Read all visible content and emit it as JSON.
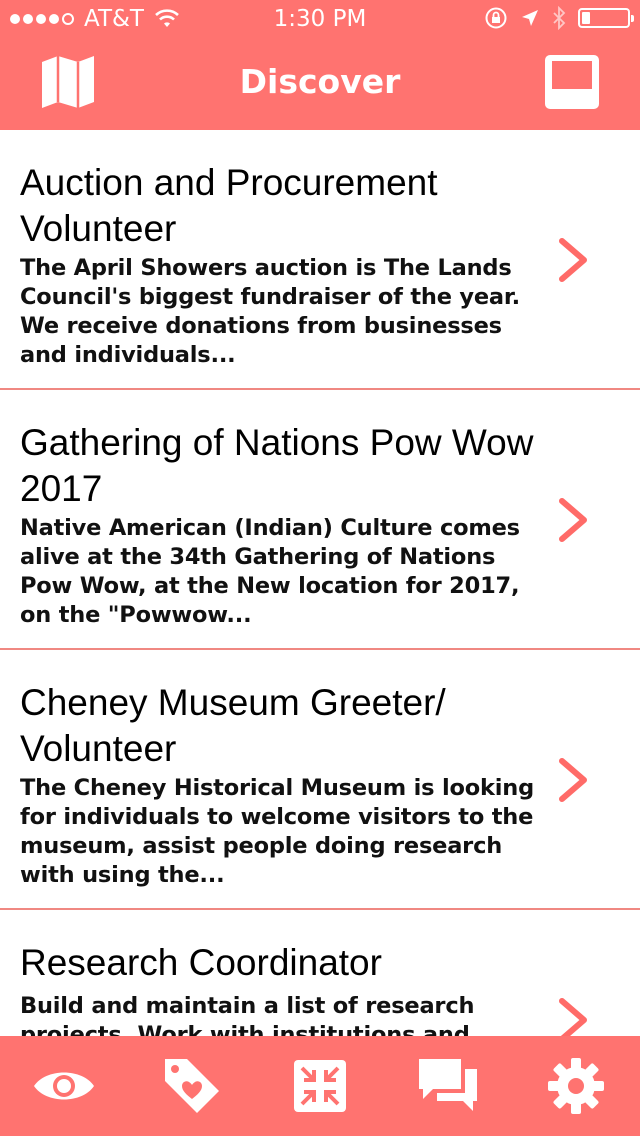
{
  "status_bar": {
    "carrier": "AT&T",
    "time": "1:30 PM",
    "signal_dots_filled": 4,
    "signal_dots_total": 5
  },
  "nav": {
    "title": "Discover",
    "left_icon": "map-icon",
    "right_icon": "inbox-icon"
  },
  "opportunities": [
    {
      "title": "Auction and Procurement Volunteer",
      "description": "The April Showers auction is The Lands Council's biggest fundraiser of the year. We receive donations from businesses and individuals..."
    },
    {
      "title": "Gathering of Nations Pow Wow 2017",
      "description": "Native American (Indian) Culture comes alive at the 34th Gathering of Nations Pow Wow, at the New location for 2017, on the \"Powwow..."
    },
    {
      "title": "Cheney Museum Greeter/ Volunteer",
      "description": "The Cheney Historical Museum is looking for individuals to welcome visitors to the museum, assist people doing research with using the..."
    },
    {
      "title": "Research Coordinator",
      "description": "Build and maintain a list of research projects. Work with institutions and others"
    }
  ],
  "tabs": [
    {
      "icon": "eye-icon"
    },
    {
      "icon": "tag-heart-icon"
    },
    {
      "icon": "expand-icon"
    },
    {
      "icon": "chat-icon"
    },
    {
      "icon": "gear-icon"
    }
  ],
  "colors": {
    "accent": "#FF7370",
    "divider": "#F08882",
    "chevron": "#FF6B68"
  }
}
